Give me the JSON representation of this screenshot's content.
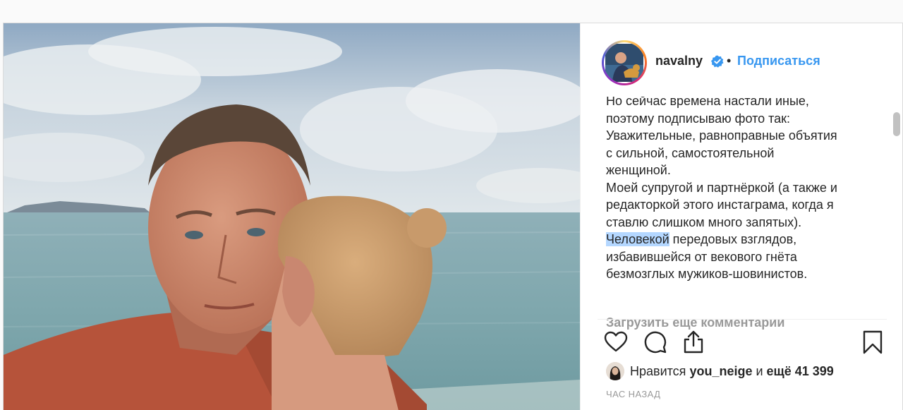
{
  "post": {
    "username": "navalny",
    "separator": "•",
    "follow_label": "Подписаться",
    "caption_lines": [
      "Но сейчас времена настали иные,",
      "поэтому подписываю фото так:",
      "Уважительные, равноправные объятия",
      "с сильной, самостоятельной",
      "женщиной.",
      "Моей супругой и партнёркой (а также и",
      "редакторкой этого инстаграма, когда я",
      "ставлю слишком много запятых)."
    ],
    "caption_highlight": "Человекой",
    "caption_after": [
      " передовых взглядов,",
      "избавившейся от векового гнёта",
      "безмозглых мужиков-шовинистов."
    ],
    "load_more_label": "Загрузить еще комментарии",
    "likes_prefix": "Нравится ",
    "likes_user": "you_neige",
    "likes_middle": " и ",
    "likes_rest": "ещё 41 399",
    "timestamp": "ЧАС НАЗАД"
  },
  "icons": {
    "like": "heart-icon",
    "comment": "comment-icon",
    "share": "share-icon",
    "save": "bookmark-icon",
    "verified": "verified-badge-icon"
  },
  "colors": {
    "link_blue": "#3897f0",
    "verified_blue": "#3897f0",
    "muted": "#999999",
    "text": "#262626",
    "selection": "#b4d7ff"
  }
}
